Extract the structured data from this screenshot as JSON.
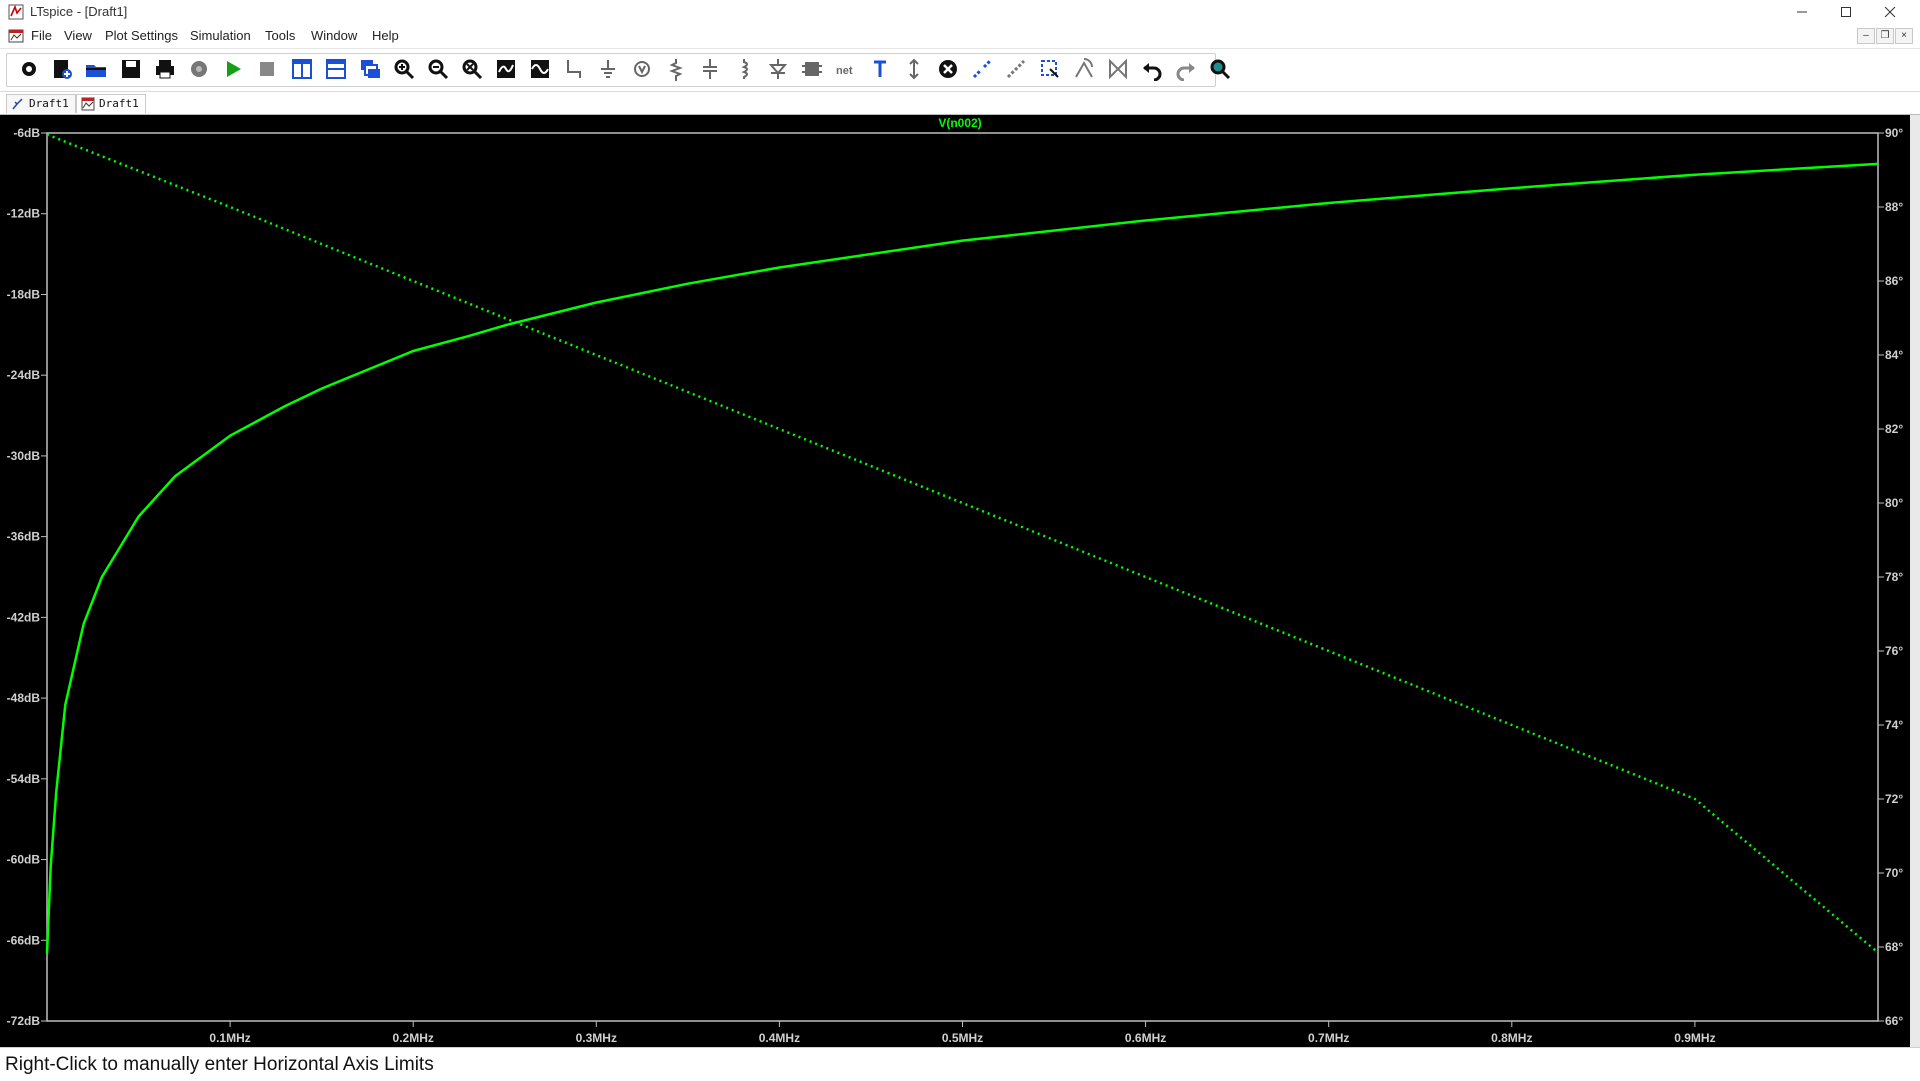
{
  "window": {
    "title": "LTspice - [Draft1]"
  },
  "menu": {
    "items": [
      "File",
      "View",
      "Plot Settings",
      "Simulation",
      "Tools",
      "Window",
      "Help"
    ]
  },
  "toolbar": {
    "icons": [
      "settings-gear-icon",
      "new-schematic-icon",
      "open-folder-icon",
      "save-icon",
      "print-icon",
      "control-panel-icon",
      "run-icon",
      "halt-icon",
      "tile-vertical-icon",
      "tile-horizontal-icon",
      "cascade-icon",
      "zoom-in-icon",
      "zoom-out-icon",
      "zoom-fit-icon",
      "autorange-icon",
      "waveform-icon",
      "wire-icon",
      "ground-icon",
      "label-net-icon",
      "resistor-icon",
      "capacitor-icon",
      "inductor-icon",
      "diode-icon",
      "component-icon",
      "net-name-icon",
      "text-icon",
      "spice-directive-icon",
      "delete-icon",
      "duplicate-icon",
      "move-icon",
      "drag-icon",
      "rotate-icon",
      "mirror-icon",
      "undo-icon",
      "redo-icon",
      "find-icon"
    ]
  },
  "tabs": [
    {
      "label": "Draft1",
      "icon": "schematic-icon"
    },
    {
      "label": "Draft1",
      "icon": "waveform-viewer-icon"
    }
  ],
  "status": {
    "text": "Right-Click to manually enter Horizontal Axis Limits"
  },
  "colors": {
    "trace": "#00ff00",
    "background": "#000000",
    "axis": "#bfbfbf",
    "grid_text": "#d0d0d0"
  },
  "chart_data": {
    "type": "line",
    "title": "V(n002)",
    "x_axis": {
      "min": 0.0,
      "max": 1.0,
      "unit": "MHz",
      "ticks": [
        0.1,
        0.2,
        0.3,
        0.4,
        0.5,
        0.6,
        0.7,
        0.8,
        0.9
      ],
      "tick_labels": [
        "0.1MHz",
        "0.2MHz",
        "0.3MHz",
        "0.4MHz",
        "0.5MHz",
        "0.6MHz",
        "0.7MHz",
        "0.8MHz",
        "0.9MHz"
      ]
    },
    "y_left": {
      "min": -72,
      "max": -6,
      "ticks": [
        -6,
        -12,
        -18,
        -24,
        -30,
        -36,
        -42,
        -48,
        -54,
        -60,
        -66,
        -72
      ],
      "tick_labels": [
        "-6dB",
        "-12dB",
        "-18dB",
        "-24dB",
        "-30dB",
        "-36dB",
        "-42dB",
        "-48dB",
        "-54dB",
        "-60dB",
        "-66dB",
        "-72dB"
      ]
    },
    "y_right": {
      "min": 66,
      "max": 90,
      "ticks": [
        90,
        88,
        86,
        84,
        82,
        80,
        78,
        76,
        74,
        72,
        70,
        68,
        66
      ],
      "tick_labels": [
        "90°",
        "88°",
        "86°",
        "84°",
        "82°",
        "80°",
        "78°",
        "76°",
        "74°",
        "72°",
        "70°",
        "68°",
        "66°"
      ]
    },
    "series": [
      {
        "style": "solid",
        "axis": "left",
        "x": [
          0.0,
          0.002,
          0.005,
          0.01,
          0.02,
          0.03,
          0.05,
          0.07,
          0.1,
          0.13,
          0.15,
          0.2,
          0.23,
          0.25,
          0.3,
          0.35,
          0.4,
          0.5,
          0.6,
          0.7,
          0.8,
          0.9,
          1.0
        ],
        "y": [
          -67.0,
          -60.5,
          -55.0,
          -48.5,
          -42.5,
          -39.0,
          -34.5,
          -31.5,
          -28.5,
          -26.3,
          -25.0,
          -22.2,
          -21.1,
          -20.3,
          -18.6,
          -17.2,
          -16.0,
          -14.0,
          -12.5,
          -11.2,
          -10.1,
          -9.1,
          -8.3
        ]
      },
      {
        "style": "dotted",
        "axis": "right",
        "x": [
          0.0,
          0.1,
          0.2,
          0.3,
          0.4,
          0.5,
          0.6,
          0.7,
          0.8,
          0.9,
          1.0
        ],
        "y": [
          89.96,
          88.0,
          86.0,
          84.0,
          82.0,
          80.0,
          78.0,
          76.0,
          74.0,
          72.0,
          67.85
        ]
      }
    ]
  }
}
